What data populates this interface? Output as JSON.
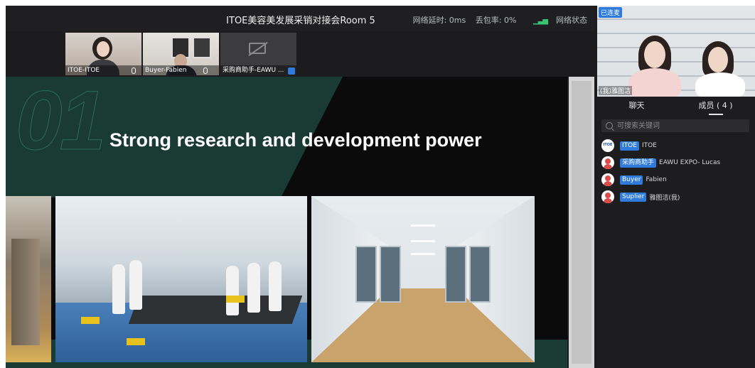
{
  "meeting": {
    "title": "ITOE美容美发展采销对接会Room 5",
    "latency": "网络延时: 0ms",
    "packet_loss": "丢包率: 0%",
    "network_status": "网络状态"
  },
  "participants": [
    {
      "label": "ITOE-ITOE"
    },
    {
      "label": "Buyer-Fabien"
    },
    {
      "label": "采购商助手-EAWU ..."
    }
  ],
  "slide": {
    "number": "01",
    "heading": "Strong research and development power"
  },
  "side_video": {
    "status_badge": "已连麦",
    "name": "(我)雅图洁"
  },
  "tabs": [
    {
      "label": "聊天"
    },
    {
      "label": "成员 ( 4 )"
    }
  ],
  "search": {
    "placeholder": "可搜索关键词"
  },
  "members": [
    {
      "role": "ITOE",
      "name": "ITOE"
    },
    {
      "role": "采购商助手",
      "name": "EAWU EXPO- Lucas"
    },
    {
      "role": "Buyer",
      "name": "Fabien"
    },
    {
      "role": "Suplier",
      "name": "雅图洁(我)"
    }
  ],
  "icons": {
    "logo_text": "ITOE"
  },
  "colors": {
    "accent": "#2f7bdc",
    "slide_green": "#1a3b33",
    "signal_green": "#37c871"
  }
}
